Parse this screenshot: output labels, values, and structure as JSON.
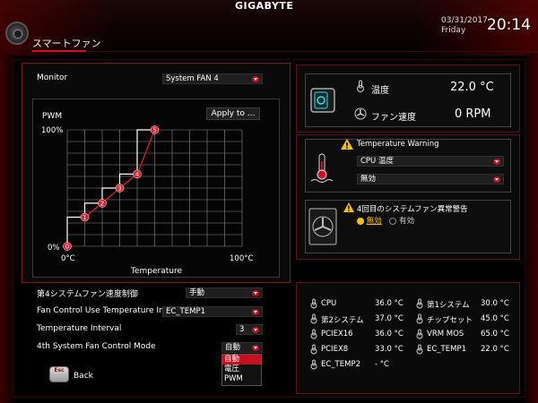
{
  "header": {
    "brand": "GIGABYTE",
    "page_title": "スマートファン",
    "date": "03/31/2017",
    "day": "Friday",
    "time": "20:14"
  },
  "left": {
    "monitor_label": "Monitor",
    "monitor_value": "System FAN 4",
    "pwm_label": "PWM",
    "apply_label": "Apply to ...",
    "y_top": "100%",
    "y_bottom": "0%",
    "x_left": "0°C",
    "x_right": "100°C",
    "x_axis_label": "Temperature",
    "speed_control_label": "第4システムファン速度制御",
    "speed_control_value": "手動",
    "temp_input_label": "Fan Control Use Temperature Input",
    "temp_input_value": "EC_TEMP1",
    "interval_label": "Temperature Interval",
    "interval_value": "3",
    "mode_label": "4th System Fan Control Mode",
    "mode_value": "自動",
    "mode_options": [
      "自動",
      "電圧",
      "PWM"
    ]
  },
  "chart_data": {
    "type": "line",
    "xlabel": "Temperature",
    "ylabel": "PWM",
    "xlim": [
      0,
      100
    ],
    "ylim": [
      0,
      100
    ],
    "points": [
      {
        "label": "0",
        "x": 0,
        "y": 0
      },
      {
        "label": "1",
        "x": 10,
        "y": 25
      },
      {
        "label": "2",
        "x": 20,
        "y": 37
      },
      {
        "label": "3",
        "x": 30,
        "y": 50
      },
      {
        "label": "4",
        "x": 40,
        "y": 62
      },
      {
        "label": "5",
        "x": 50,
        "y": 100
      }
    ]
  },
  "status": {
    "temp_label": "温度",
    "temp_value": "22.0 °C",
    "fan_label": "ファン速度",
    "fan_value": "0 RPM"
  },
  "warning": {
    "title": "Temperature Warning",
    "source": "CPU 温度",
    "value": "無効"
  },
  "fan_fail": {
    "title": "4回目のシステムファン異常警告",
    "off_label": "無効",
    "on_label": "有効"
  },
  "monitor_list": [
    {
      "name": "CPU",
      "value": "36.0 °C"
    },
    {
      "name": "第1システム",
      "value": "30.0 °C"
    },
    {
      "name": "第2システム",
      "value": "37.0 °C"
    },
    {
      "name": "チップセット",
      "value": "45.0 °C"
    },
    {
      "name": "PCIEX16",
      "value": "36.0 °C"
    },
    {
      "name": "VRM MOS",
      "value": "65.0 °C"
    },
    {
      "name": "PCIEX8",
      "value": "33.0 °C"
    },
    {
      "name": "EC_TEMP1",
      "value": "22.0 °C"
    },
    {
      "name": "EC_TEMP2",
      "value": "- °C"
    }
  ],
  "footer": {
    "esc_label": "Esc",
    "back_label": "Back"
  },
  "colors": {
    "accent": "#c8141e",
    "value_cyan": "#43d8e0"
  }
}
